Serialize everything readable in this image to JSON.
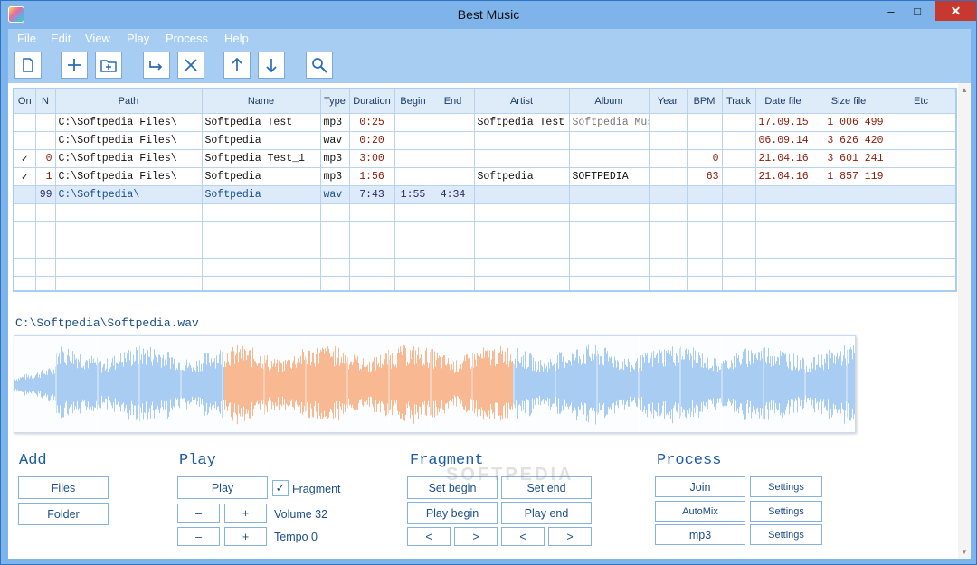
{
  "window": {
    "title": "Best Music"
  },
  "menu": [
    "File",
    "Edit",
    "View",
    "Play",
    "Process",
    "Help"
  ],
  "toolbar": [
    {
      "icon": "new-file-icon"
    },
    {
      "icon": "add-icon"
    },
    {
      "icon": "add-folder-icon"
    },
    {
      "icon": "move-icon"
    },
    {
      "icon": "delete-icon"
    },
    {
      "icon": "arrow-up-icon"
    },
    {
      "icon": "arrow-down-icon"
    },
    {
      "icon": "search-icon"
    }
  ],
  "table": {
    "columns": [
      "On",
      "N",
      "Path",
      "Name",
      "Type",
      "Duration",
      "Begin",
      "End",
      "Artist",
      "Album",
      "Year",
      "BPM",
      "Track",
      "Date file",
      "Size file",
      "Etc"
    ],
    "rows": [
      {
        "on": "",
        "n": "",
        "path": "C:\\Softpedia Files\\",
        "name": "Softpedia Test",
        "type": "mp3",
        "duration": "0:25",
        "begin": "",
        "end": "",
        "artist": "Softpedia Test",
        "album": "Softpedia Music",
        "year": "",
        "bpm": "",
        "track": "",
        "date": "17.09.15",
        "size": "1 006 499",
        "etc": ""
      },
      {
        "on": "",
        "n": "",
        "path": "C:\\Softpedia Files\\",
        "name": "Softpedia",
        "type": "wav",
        "duration": "0:20",
        "begin": "",
        "end": "",
        "artist": "",
        "album": "",
        "year": "",
        "bpm": "",
        "track": "",
        "date": "06.09.14",
        "size": "3 626 420",
        "etc": ""
      },
      {
        "on": "✓",
        "n": "0",
        "path": "C:\\Softpedia Files\\",
        "name": "Softpedia Test_1",
        "type": "mp3",
        "duration": "3:00",
        "begin": "",
        "end": "",
        "artist": "",
        "album": "",
        "year": "",
        "bpm": "0",
        "track": "",
        "date": "21.04.16",
        "size": "3 601 241",
        "etc": ""
      },
      {
        "on": "✓",
        "n": "1",
        "path": "C:\\Softpedia Files\\",
        "name": "Softpedia",
        "type": "mp3",
        "duration": "1:56",
        "begin": "",
        "end": "",
        "artist": "Softpedia",
        "album": "SOFTPEDIA",
        "year": "",
        "bpm": "63",
        "track": "",
        "date": "21.04.16",
        "size": "1 857 119",
        "etc": ""
      },
      {
        "on": "",
        "n": "99",
        "path": "C:\\Softpedia\\",
        "name": "Softpedia",
        "type": "wav",
        "duration": "7:43",
        "begin": "1:55",
        "end": "4:34",
        "artist": "",
        "album": "",
        "year": "",
        "bpm": "",
        "track": "",
        "date": "",
        "size": "",
        "etc": ""
      }
    ]
  },
  "wave": {
    "path": "C:\\Softpedia\\Softpedia.wav",
    "fragment_start_fraction": 0.249,
    "fragment_end_fraction": 0.591,
    "colors": {
      "wave": "#a9ccf2",
      "fragment": "#f8b892"
    }
  },
  "add": {
    "title": "Add",
    "files": "Files",
    "folder": "Folder"
  },
  "play": {
    "title": "Play",
    "play": "Play",
    "fragment_label": "Fragment",
    "fragment_checked": true,
    "minus": "–",
    "plus": "+",
    "volume": "Volume 32",
    "tempo": "Tempo 0"
  },
  "fragment": {
    "title": "Fragment",
    "set_begin": "Set begin",
    "set_end": "Set end",
    "play_begin": "Play begin",
    "play_end": "Play end",
    "prev": "<",
    "next": ">"
  },
  "process": {
    "title": "Process",
    "join": "Join",
    "automix": "AutoMix",
    "mp3": "mp3",
    "settings": "Settings"
  },
  "watermark": "SOFTPEDIA"
}
